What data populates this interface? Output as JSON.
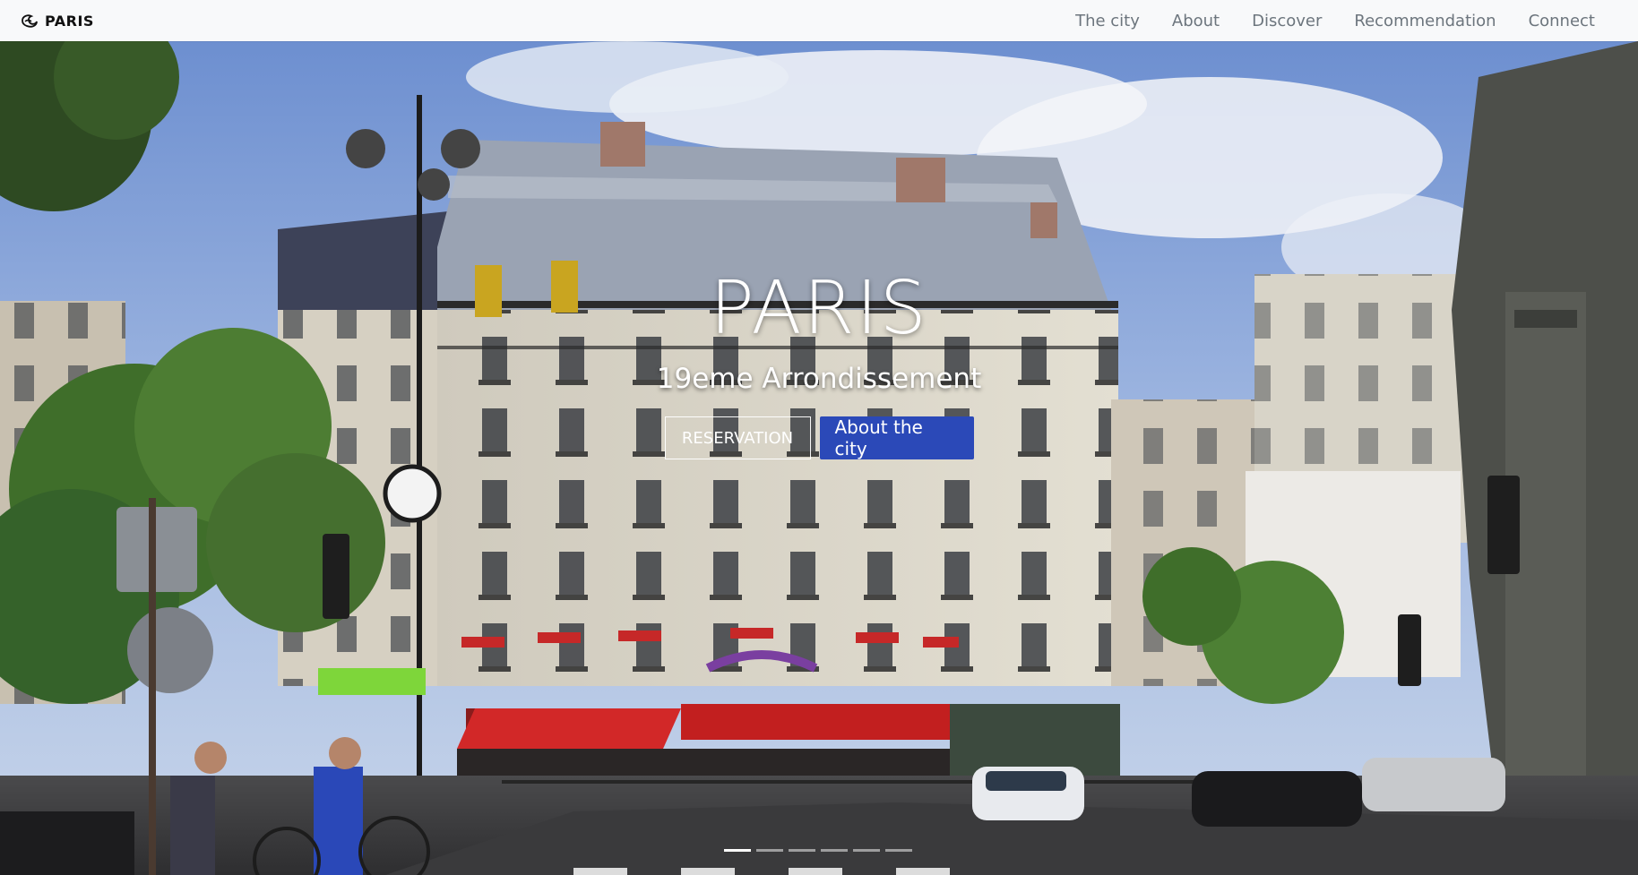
{
  "brand": {
    "name": "PARIS",
    "icon": "paris-logo-icon"
  },
  "nav": {
    "links": [
      "The city",
      "About",
      "Discover",
      "Recommendation",
      "Connect"
    ]
  },
  "hero": {
    "title": "PARIS",
    "subtitle": "19eme Arrondissement",
    "primary_button": "About the city",
    "outline_button": "RESERVATION",
    "slide_count": 6,
    "active_slide": 1
  },
  "colors": {
    "navbar_bg": "#f8f9fa",
    "nav_link": "#6c757d",
    "primary": "#2b49b8"
  }
}
